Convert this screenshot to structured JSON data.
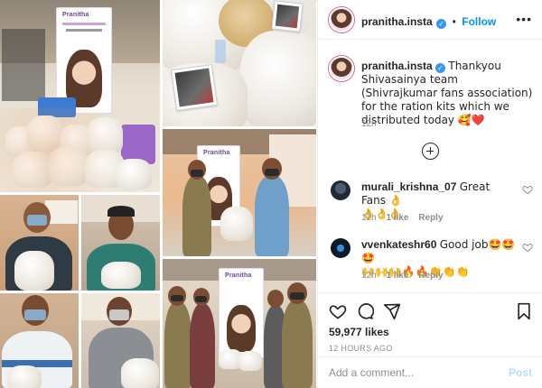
{
  "post": {
    "username": "pranitha.insta",
    "verified_badge": "verified-badge",
    "follow_separator": "•",
    "follow_label": "Follow",
    "more_options": "•••",
    "caption_text": "Thankyou Shivasainya team (Shivrajkumar fans association) for the ration kits which we distributed today 🥰❤️",
    "caption_time": "12h",
    "photo_banner_logo": "Pranitha",
    "load_more_icon": "plus-circle-icon"
  },
  "comments": [
    {
      "username": "murali_krishna_07",
      "text": "Great Fans 👌",
      "text2": "👌👌👌",
      "time": "12h",
      "likes": "1 like",
      "reply": "Reply"
    },
    {
      "username": "vvenkateshr60",
      "text": "Good job🤩🤩🤩",
      "text2": "🙌🙌🙌🔥🔥👏👏👏",
      "time": "12h",
      "likes": "1 like",
      "reply": "Reply"
    }
  ],
  "actions": {
    "likes_count": "59,977 likes",
    "timestamp": "12 HOURS AGO",
    "icons": [
      "heart-icon",
      "comment-icon",
      "share-icon",
      "bookmark-icon"
    ]
  },
  "add_comment": {
    "placeholder": "Add a comment...",
    "post_label": "Post"
  },
  "colors": {
    "link_blue": "#0095f6",
    "text": "#262626",
    "secondary": "#8e8e8e",
    "story_ring": "#e35a8b"
  }
}
